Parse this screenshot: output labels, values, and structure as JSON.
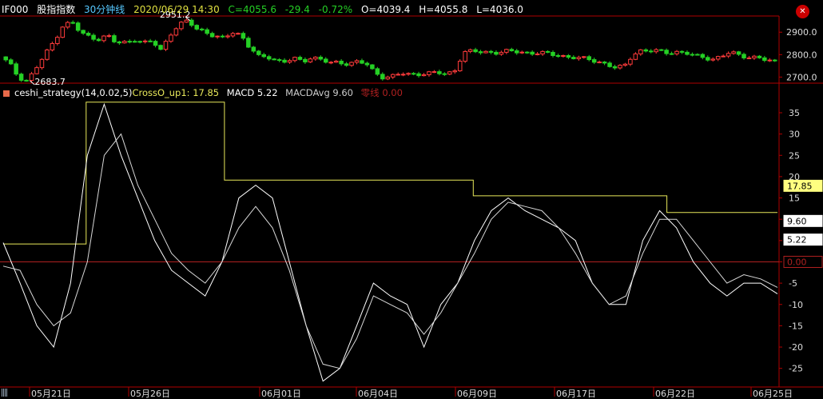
{
  "header": {
    "symbol": "IF000",
    "name": "股指指数",
    "period": "30分钟线",
    "datetime": "2020/06/29 14:30",
    "close": "C=4055.6",
    "change": "-29.4",
    "pct": "-0.72%",
    "open": "O=4039.4",
    "high": "H=4055.8",
    "low": "L=4036.0"
  },
  "indicator": {
    "name": "ceshi_strategy(14,0.02,5)",
    "cross": "CrossO_up1: 17.85",
    "macd": "MACD 5.22",
    "avg": "MACDAvg 9.60",
    "zero": "零线 0.00"
  },
  "colors": {
    "up": "#ff3b3b",
    "down": "#25d025",
    "cross_line": "#e8e85a",
    "zero_line": "#b02020",
    "macd": "#ffffff",
    "avg": "#d8d8d8",
    "separator": "#b00000"
  },
  "close_icon": "close-circle-icon",
  "chart_data": [
    {
      "type": "candlestick",
      "y_ticks": [
        "2900.0",
        "2800.0",
        "2700.0"
      ],
      "ylim": [
        2680,
        2965
      ],
      "annotations": [
        {
          "label": "2951.2",
          "value": 2951.2
        },
        {
          "label": "2683.7",
          "value": 2683.7
        }
      ],
      "close_path": [
        2790,
        2760,
        2700,
        2684,
        2740,
        2800,
        2860,
        2930,
        2945,
        2895,
        2880,
        2870,
        2885,
        2850,
        2855,
        2870,
        2850,
        2860,
        2820,
        2890,
        2930,
        2951,
        2915,
        2905,
        2880,
        2870,
        2900,
        2890,
        2830,
        2790,
        2790,
        2775,
        2770,
        2780,
        2770,
        2790,
        2780,
        2760,
        2765,
        2760,
        2770,
        2760,
        2720,
        2700,
        2705,
        2715,
        2710,
        2715,
        2718,
        2720,
        2710,
        2730,
        2810,
        2815,
        2810,
        2812,
        2810,
        2815,
        2812,
        2810,
        2808,
        2806,
        2800,
        2795,
        2790,
        2783,
        2780,
        2770,
        2760,
        2740,
        2745,
        2800,
        2820,
        2815,
        2815,
        2810,
        2812,
        2805,
        2795,
        2790,
        2780,
        2790,
        2810,
        2800,
        2790,
        2785,
        2775,
        2770
      ]
    },
    {
      "type": "line",
      "y_ticks": [
        "35",
        "30",
        "25",
        "20",
        "15",
        "10",
        "5",
        "0",
        "-5",
        "-10",
        "-15",
        "-20",
        "-25"
      ],
      "ylim": [
        -29,
        38
      ],
      "value_labels": [
        "17.85",
        "9.60",
        "5.22",
        "0.00"
      ],
      "series": [
        {
          "name": "CrossO_up1",
          "values": [
            4.2,
            4.2,
            4.2,
            37.5,
            37.5,
            37.5,
            37.5,
            37.5,
            19.2,
            19.2,
            19.2,
            19.2,
            19.2,
            19.2,
            19.2,
            19.2,
            19.2,
            15.5,
            15.5,
            15.5,
            15.5,
            15.5,
            15.5,
            15.5,
            11.6,
            11.6,
            11.6,
            11.6
          ]
        },
        {
          "name": "MACD",
          "values": [
            4.5,
            -5,
            -15,
            -20,
            -5,
            25,
            37,
            25,
            15,
            5,
            -2,
            -5,
            -8,
            0,
            15,
            18,
            15,
            0,
            -15,
            -28,
            -25,
            -15,
            -5,
            -8,
            -10,
            -20,
            -10,
            -5,
            5,
            12,
            15,
            12,
            10,
            8,
            5,
            -5,
            -10,
            -10,
            5,
            12,
            8,
            0,
            -5,
            -8,
            -5,
            -5,
            -7.5
          ]
        },
        {
          "name": "MACDAvg",
          "values": [
            -1,
            -2,
            -10,
            -15,
            -12,
            0,
            25,
            30,
            18,
            10,
            2,
            -2,
            -5,
            0,
            8,
            13,
            8,
            -2,
            -15,
            -24,
            -25,
            -18,
            -8,
            -10,
            -12,
            -17,
            -12,
            -5,
            2,
            10,
            14,
            13,
            12,
            8,
            2,
            -5,
            -10,
            -8,
            2,
            10,
            10,
            5,
            0,
            -5,
            -3,
            -4,
            -6
          ]
        }
      ]
    }
  ],
  "x_axis": [
    "05月21日",
    "05月26日",
    "06月01日",
    "06月04日",
    "06月09日",
    "06月17日",
    "06月22日",
    "06月25日"
  ]
}
